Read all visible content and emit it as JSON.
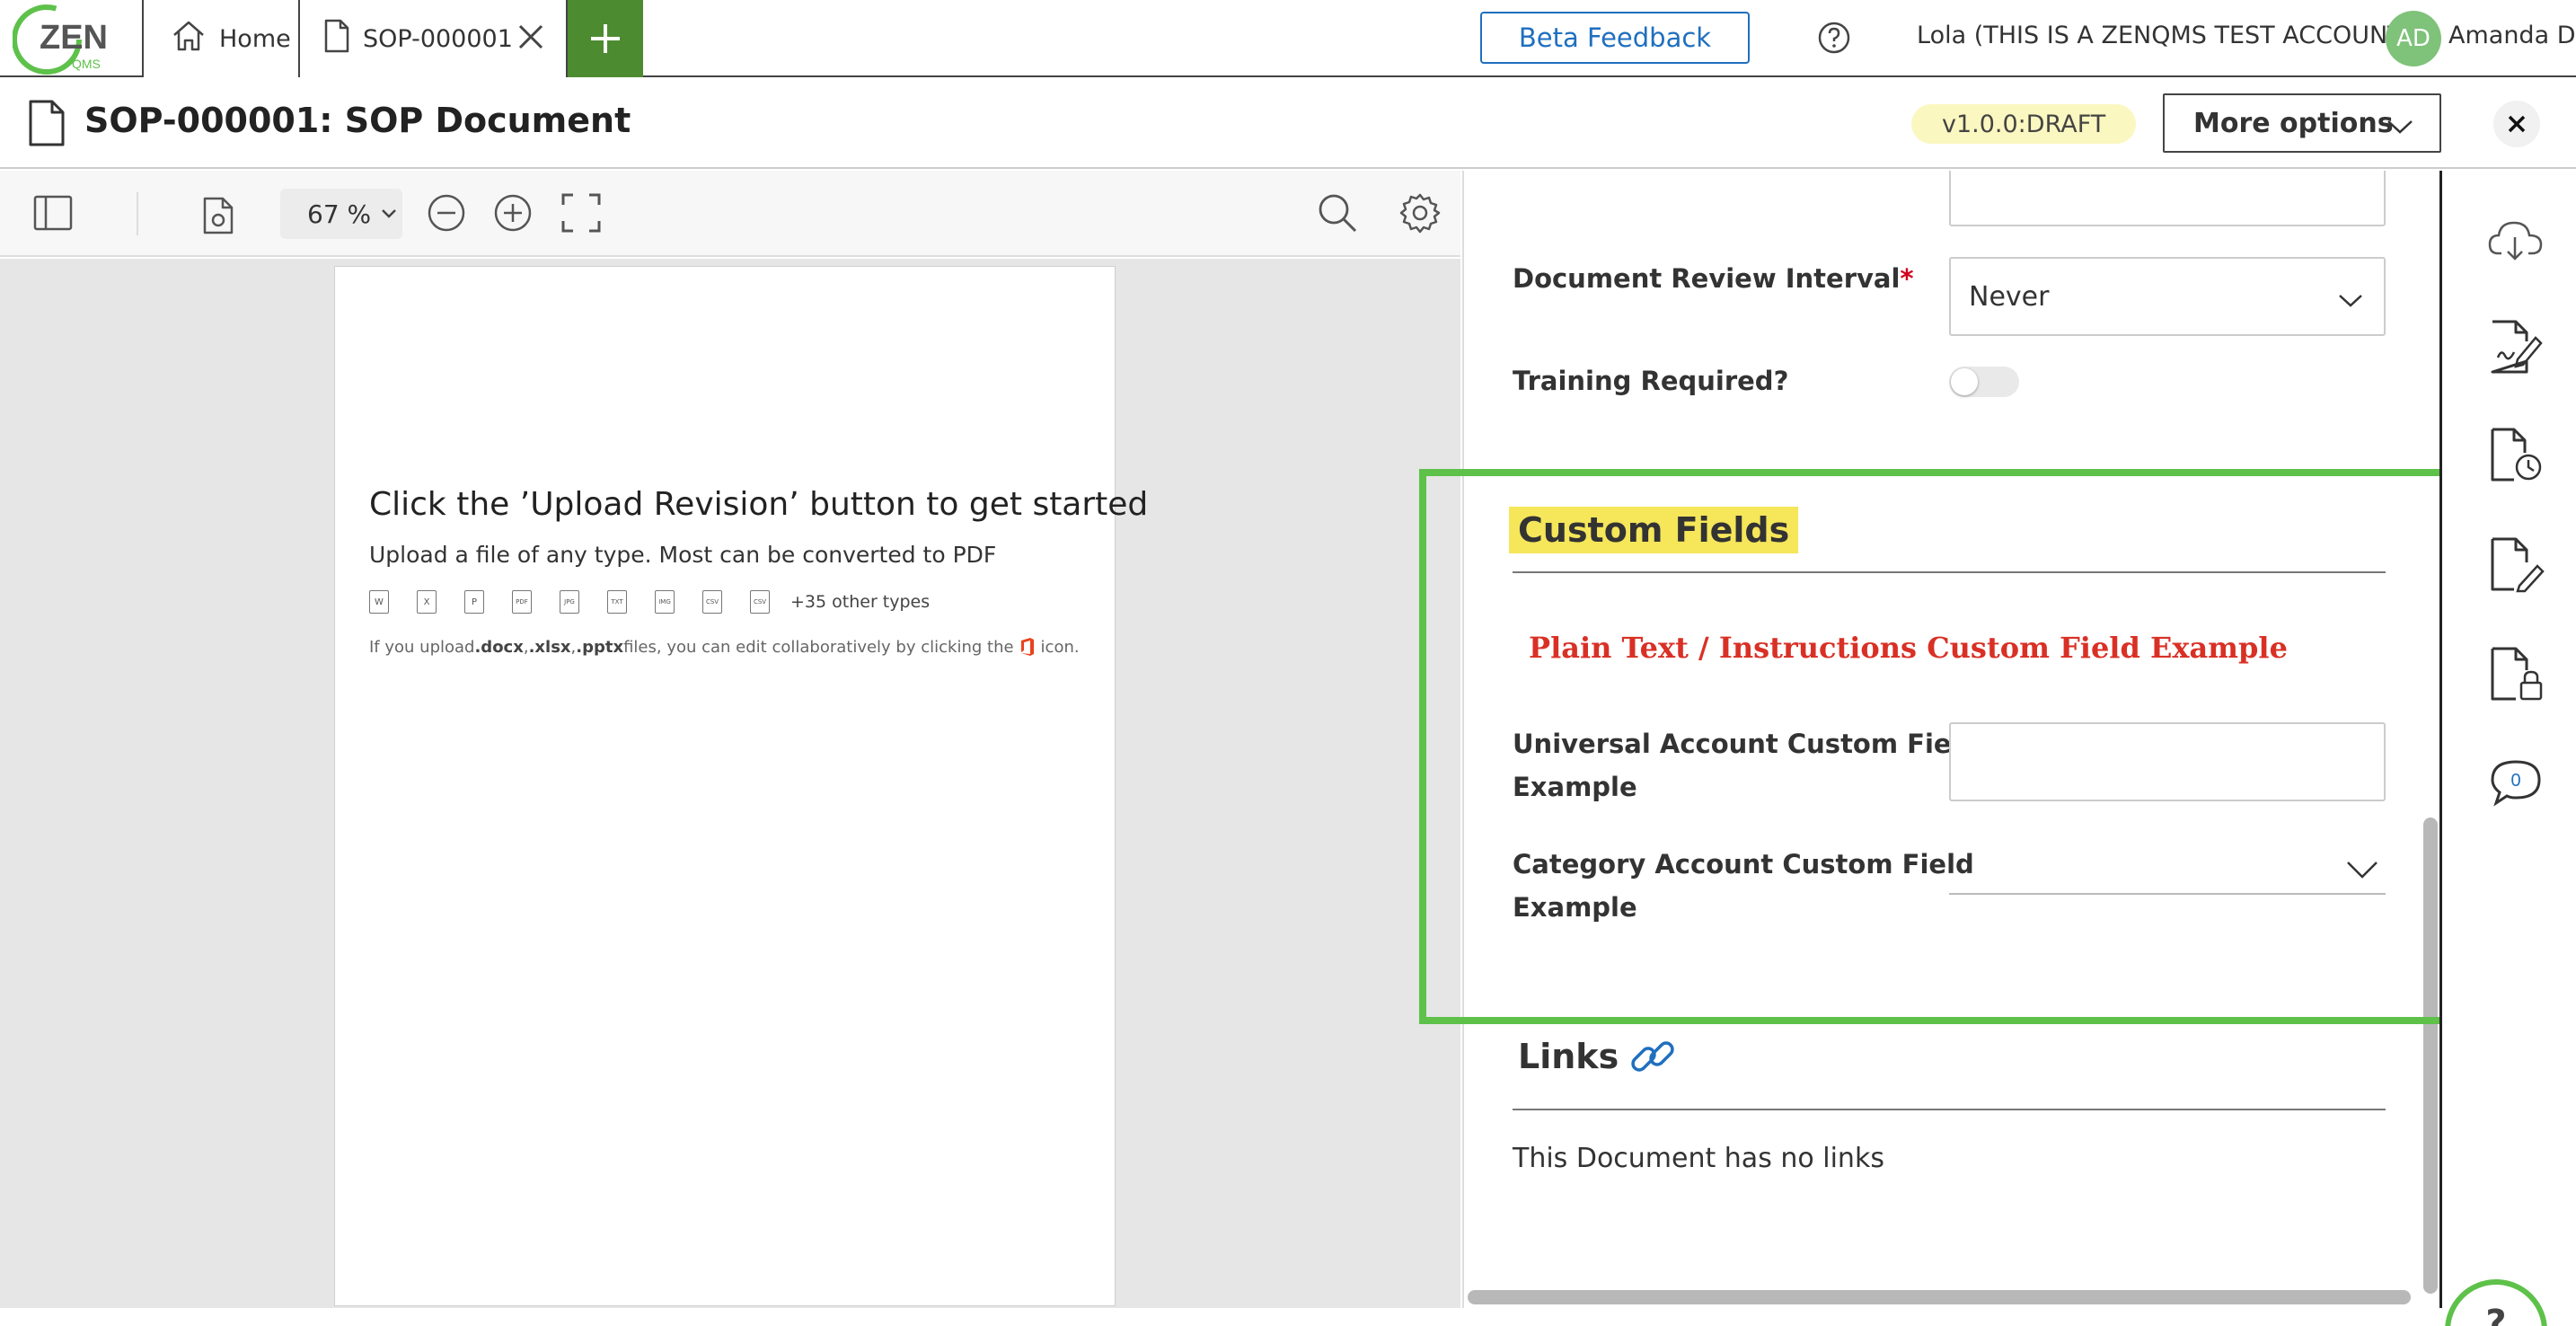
{
  "app": {
    "logo_text": "ZEN",
    "logo_sub": "QMS"
  },
  "tabs": [
    {
      "label": "Home",
      "icon": "home-icon"
    },
    {
      "label": "SOP-000001",
      "icon": "document-icon"
    }
  ],
  "topbar": {
    "beta_feedback": "Beta Feedback",
    "account": "Lola (THIS IS A ZENQMS TEST ACCOUNT)",
    "avatar_initials": "AD",
    "user_name": "Amanda D"
  },
  "document": {
    "title": "SOP-000001: SOP Document",
    "version": "v1.0.0:DRAFT",
    "more_options": "More options"
  },
  "viewer": {
    "zoom": "67 %",
    "heading": "Click the ’Upload Revision’ button to get started",
    "subheading": "Upload a file of any type. Most can be converted to PDF",
    "file_type_icons": [
      "W",
      "X",
      "P",
      "PDF",
      "JPG",
      "TXT",
      "IMG",
      "CSV",
      "CSV"
    ],
    "more_types": "+35 other types",
    "note_prefix": "If you upload ",
    "note_ext1": ".docx",
    "note_sep1": ", ",
    "note_ext2": ".xlsx",
    "note_sep2": ", ",
    "note_ext3": ".pptx",
    "note_suffix": " files, you can edit collaboratively by clicking the",
    "note_end": "icon."
  },
  "properties": {
    "review_interval_label": "Document Review Interval",
    "review_interval_value": "Never",
    "training_label": "Training Required?",
    "training_enabled": false,
    "custom_fields_title": "Custom Fields",
    "instructions_text": "Plain Text / Instructions Custom Field Example",
    "universal_label_line1": "Universal Account Custom Field",
    "universal_label_line2": "Example",
    "universal_value": "",
    "category_label_line1": "Category Account Custom Field",
    "category_label_line2": "Example",
    "category_value": "",
    "links_title": "Links",
    "no_links": "This Document has no links"
  },
  "rail": {
    "comments_count": "0",
    "icons": [
      "cloud-download-icon",
      "sign-document-icon",
      "document-history-icon",
      "edit-document-icon",
      "lock-document-icon",
      "comments-icon"
    ]
  },
  "help_fab": "?",
  "colors": {
    "brand_green": "#4d8b31",
    "highlight_green": "#5ec14a",
    "link_blue": "#1f6fbf",
    "required_red": "#d0021b",
    "instruction_red": "#d93025",
    "title_highlight": "#f5e65a"
  }
}
